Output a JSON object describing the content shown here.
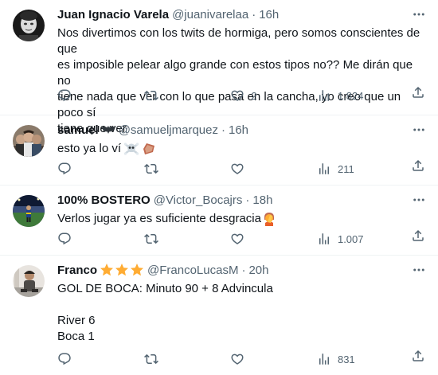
{
  "colors": {
    "text_primary": "#0f1419",
    "text_secondary": "#536471",
    "divider": "#eff3f4",
    "background": "#ffffff"
  },
  "tweets": [
    {
      "name": "Juan Ignacio Varela",
      "handle": "@juanivarelaa",
      "time": "16h",
      "lines": [
        "Nos divertimos con los twits de hormiga, pero somos conscientes de que",
        "es imposible pelear algo grande con estos tipos no?? Me dirán que no",
        "tiene nada que ver con lo que pasa en la cancha, yo creo que un poco sí",
        "tiene que ver"
      ],
      "replies": "",
      "retweets": "",
      "likes": "2",
      "views": "1.824",
      "avatar": "dark-portrait"
    },
    {
      "name": "samuel",
      "name_emoji": "bat-emoji",
      "handle": "@samueljmarquez",
      "time": "16h",
      "lines": [
        "esto ya lo ví"
      ],
      "body_emojis": [
        "skull-crossbones-emoji",
        "coffin-emoji"
      ],
      "replies": "",
      "retweets": "",
      "likes": "",
      "views": "211",
      "avatar": "group-photo"
    },
    {
      "name": "100% BOSTERO",
      "handle": "@Victor_Bocajrs",
      "time": "18h",
      "lines": [
        "Verlos jugar ya es suficiente desgracia"
      ],
      "body_emojis": [
        "facepalm-emoji"
      ],
      "replies": "",
      "retweets": "",
      "likes": "",
      "views": "1.007",
      "avatar": "stadium-photo"
    },
    {
      "name": "Franco",
      "name_emoji": "three-stars-emoji",
      "handle": "@FrancoLucasM",
      "time": "20h",
      "lines": [
        "GOL DE BOCA: Minuto 90 + 8 Advincula",
        "",
        "River 6",
        "Boca 1"
      ],
      "replies": "",
      "retweets": "",
      "likes": "",
      "views": "831",
      "avatar": "person-photo"
    }
  ]
}
